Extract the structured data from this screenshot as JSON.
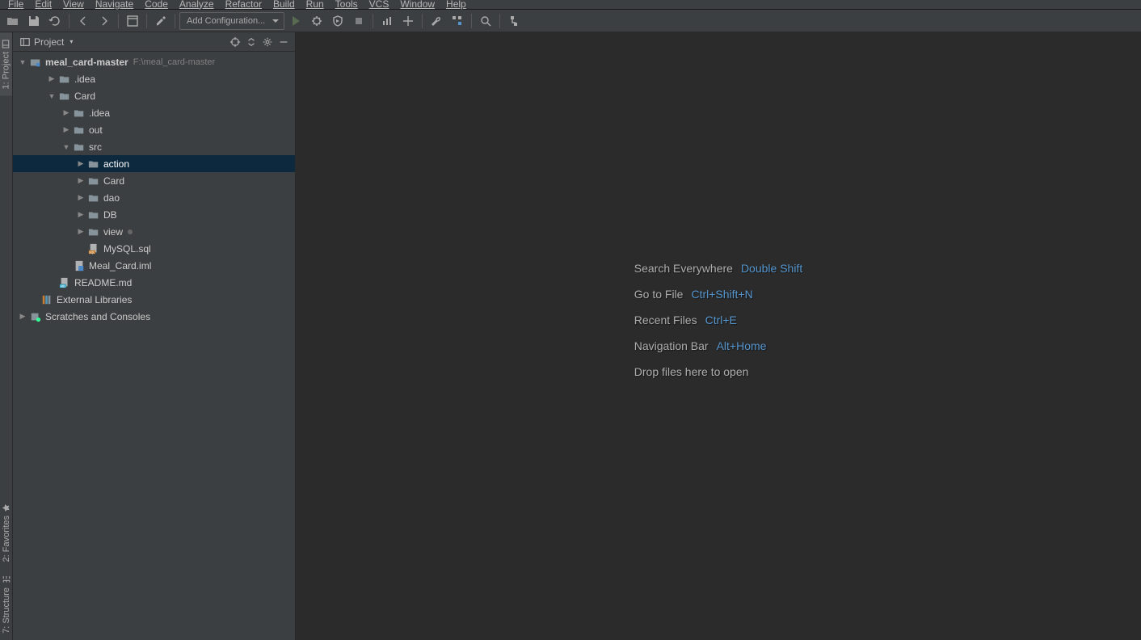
{
  "menu": {
    "items": [
      "File",
      "Edit",
      "View",
      "Navigate",
      "Code",
      "Analyze",
      "Refactor",
      "Build",
      "Run",
      "Tools",
      "VCS",
      "Window",
      "Help"
    ]
  },
  "toolbar": {
    "config_label": "Add Configuration..."
  },
  "sidebar": {
    "title": "Project",
    "project_name": "meal_card-master",
    "project_path": "F:\\meal_card-master",
    "tree": [
      {
        "label": ".idea",
        "icon": "folder",
        "arrow": "right",
        "indent": 2
      },
      {
        "label": "Card",
        "icon": "folder",
        "arrow": "down",
        "indent": 2
      },
      {
        "label": ".idea",
        "icon": "folder",
        "arrow": "right",
        "indent": 3
      },
      {
        "label": "out",
        "icon": "folder",
        "arrow": "right",
        "indent": 3
      },
      {
        "label": "src",
        "icon": "folder",
        "arrow": "down",
        "indent": 3
      },
      {
        "label": "action",
        "icon": "folder",
        "arrow": "right",
        "indent": 4,
        "selected": true
      },
      {
        "label": "Card",
        "icon": "folder",
        "arrow": "right",
        "indent": 4
      },
      {
        "label": "dao",
        "icon": "folder",
        "arrow": "right",
        "indent": 4
      },
      {
        "label": "DB",
        "icon": "folder",
        "arrow": "right",
        "indent": 4
      },
      {
        "label": "view",
        "icon": "folder",
        "arrow": "right",
        "indent": 4,
        "dot": true
      },
      {
        "label": "MySQL.sql",
        "icon": "sql",
        "arrow": "",
        "indent": 4
      },
      {
        "label": "Meal_Card.iml",
        "icon": "iml",
        "arrow": "",
        "indent": 3
      },
      {
        "label": "README.md",
        "icon": "md",
        "arrow": "",
        "indent": 2
      }
    ],
    "external_libs": "External Libraries",
    "scratches": "Scratches and Consoles"
  },
  "welcome": {
    "lines": [
      {
        "text": "Search Everywhere",
        "shortcut": "Double Shift"
      },
      {
        "text": "Go to File",
        "shortcut": "Ctrl+Shift+N"
      },
      {
        "text": "Recent Files",
        "shortcut": "Ctrl+E"
      },
      {
        "text": "Navigation Bar",
        "shortcut": "Alt+Home"
      },
      {
        "text": "Drop files here to open",
        "shortcut": ""
      }
    ]
  },
  "left_gutter": {
    "project_tab": "1: Project",
    "favorites_tab": "2: Favorites",
    "structure_tab": "7: Structure"
  }
}
